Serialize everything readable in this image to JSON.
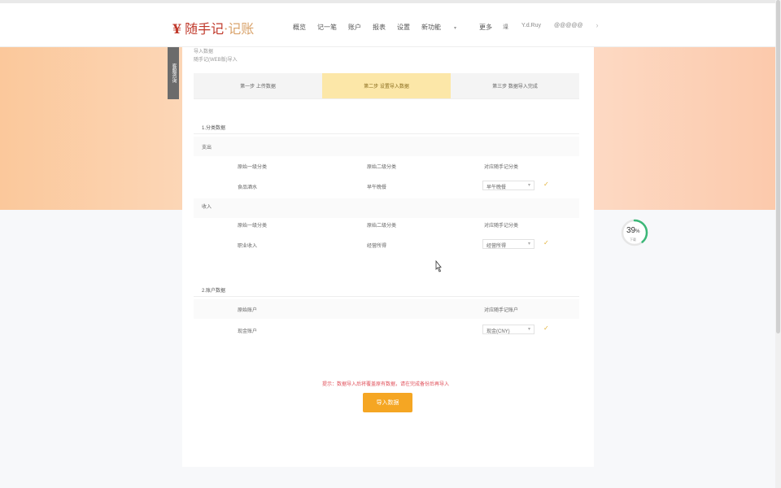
{
  "header": {
    "logo_yen": "¥",
    "logo_main": "随手记",
    "logo_sep": "·",
    "logo_sub": "记账",
    "nav": [
      "概览",
      "记一笔",
      "账户",
      "报表",
      "设置",
      "新功能",
      "更多"
    ],
    "nav_with_caret": [
      5,
      6
    ],
    "right_items": [
      "退",
      "Y.d.Ruy",
      "@@@@@"
    ]
  },
  "sidebar_tab": "客服咨询",
  "crumbs": {
    "line1": "导入数据",
    "line2": "随手记(WEB版)导入"
  },
  "steps": [
    {
      "label": "第一步 上传数据",
      "active": false
    },
    {
      "label": "第二步 设置导入数据",
      "active": true
    },
    {
      "label": "第三步 数据导入完成",
      "active": false
    }
  ],
  "section1": {
    "title": "1.分类数据",
    "expense": {
      "label": "支出",
      "headers": [
        "原始一级分类",
        "原始二级分类",
        "对应随手记分类"
      ],
      "row": [
        "食品酒水",
        "早午晚餐",
        "早午晚餐"
      ]
    },
    "income": {
      "label": "收入",
      "headers": [
        "原始一级分类",
        "原始二级分类",
        "对应随手记分类"
      ],
      "row": [
        "职业收入",
        "经营所得",
        "经营所得"
      ]
    }
  },
  "section2": {
    "title": "2.账户数据",
    "headers": [
      "原始账户",
      "对应随手记账户"
    ],
    "row": [
      "现金账户",
      "现金(CNY)"
    ]
  },
  "warning": "提示：数据导入后将覆盖原有数据，请在完成备份后再导入",
  "import_button": "导入数据",
  "progress": {
    "value": 39,
    "label": "39",
    "unit": "%",
    "sub": "下载"
  },
  "colors": {
    "accent": "#f5a623",
    "active_step": "#fce7a8",
    "check": "#e3b33a",
    "progress_ring": "#3cb878"
  }
}
